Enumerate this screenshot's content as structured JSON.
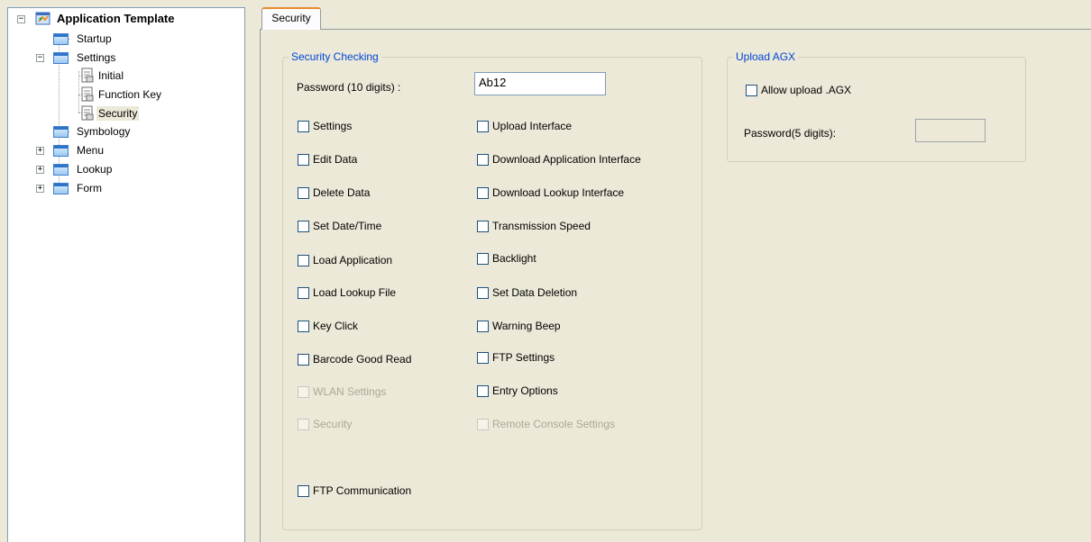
{
  "tree": {
    "root": "Application Template",
    "startup": "Startup",
    "settings": "Settings",
    "initial": "Initial",
    "function_key": "Function Key",
    "security": "Security",
    "symbology": "Symbology",
    "menu": "Menu",
    "lookup": "Lookup",
    "form": "Form"
  },
  "tab": {
    "label": "Security"
  },
  "security_checking": {
    "title": "Security Checking",
    "password_label": "Password (10 digits) :",
    "password_value": "Ab12",
    "left": [
      "Settings",
      "Edit Data",
      "Delete Data",
      "Set Date/Time",
      "Load Application",
      "Load Lookup File",
      "Key Click",
      "Barcode Good Read",
      "WLAN Settings",
      "Security"
    ],
    "right": [
      "Upload Interface",
      "Download Application Interface",
      "Download Lookup Interface",
      "Transmission Speed",
      "Backlight",
      "Set Data Deletion",
      "Warning Beep",
      "FTP Settings",
      "Entry Options",
      "Remote Console Settings"
    ],
    "ftp": "FTP Communication"
  },
  "upload_agx": {
    "title": "Upload AGX",
    "allow_label": "Allow upload .AGX",
    "password_label": "Password(5 digits):",
    "password_value": ""
  },
  "colors": {
    "group_title": "#0046d5",
    "tab_accent": "#e68b2c",
    "background": "#ece9d8"
  }
}
